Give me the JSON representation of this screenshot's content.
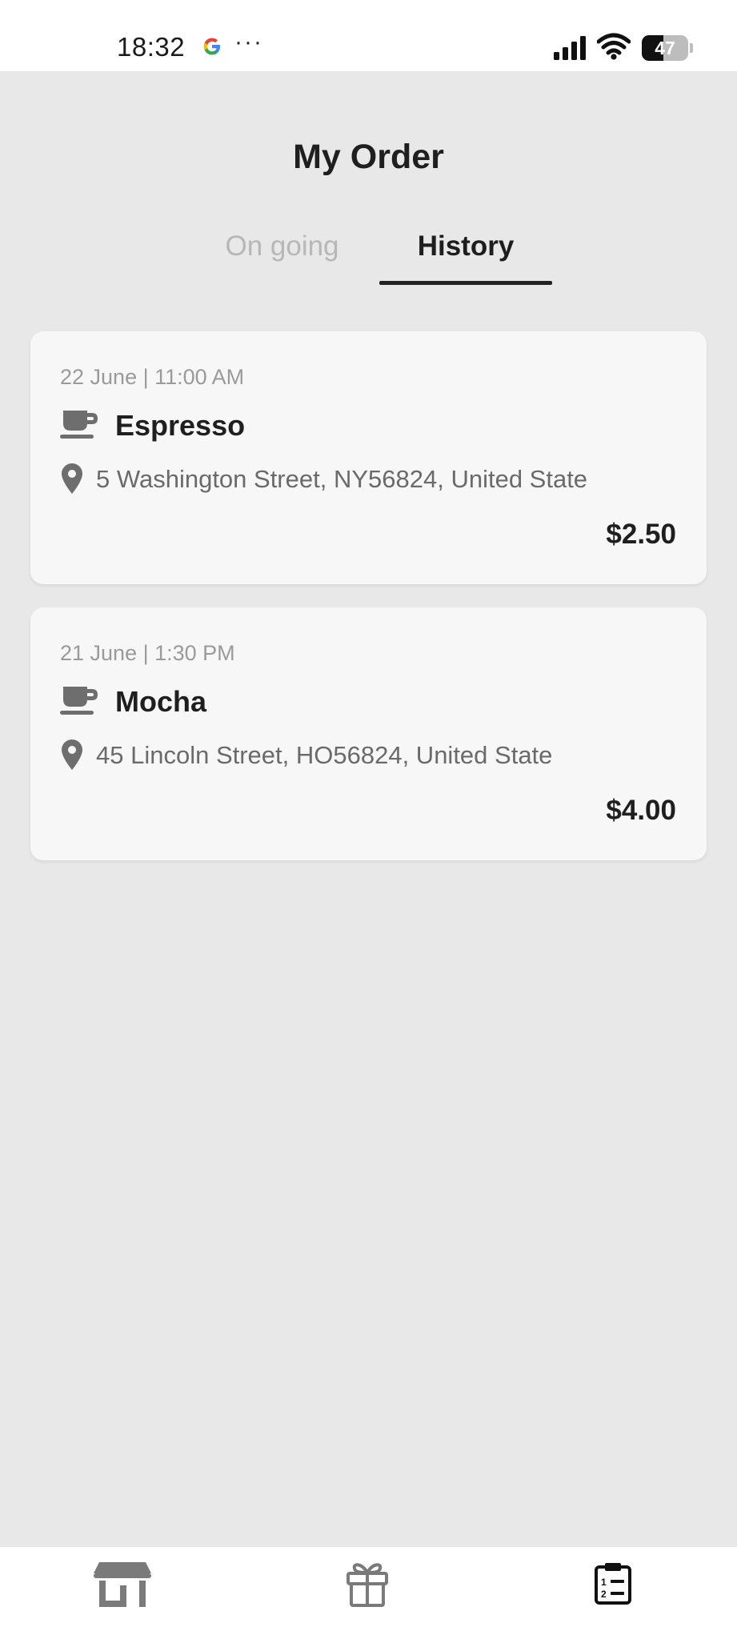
{
  "status_bar": {
    "time": "18:32",
    "more": "···",
    "battery": "47",
    "battery_level": 0.47
  },
  "header": {
    "title": "My Order"
  },
  "tabs": [
    {
      "label": "On going",
      "active": false
    },
    {
      "label": "History",
      "active": true
    }
  ],
  "orders": [
    {
      "date": "22 June | 11:00 AM",
      "name": "Espresso",
      "address": "5 Washington Street, NY56824, United State",
      "price": "$2.50"
    },
    {
      "date": "21 June | 1:30 PM",
      "name": "Mocha",
      "address": "45 Lincoln Street, HO56824, United State",
      "price": "$4.00"
    }
  ],
  "bottom_nav": {
    "items": [
      {
        "icon": "store-icon",
        "active": false
      },
      {
        "icon": "gift-icon",
        "active": false
      },
      {
        "icon": "orders-clipboard-icon",
        "active": true
      }
    ]
  },
  "colors": {
    "background": "#e8e8e8",
    "card": "#f7f7f7",
    "text_primary": "#1f1f1f",
    "tab_inactive": "#b7b7b7",
    "icon_gray": "#7a7a7a"
  }
}
